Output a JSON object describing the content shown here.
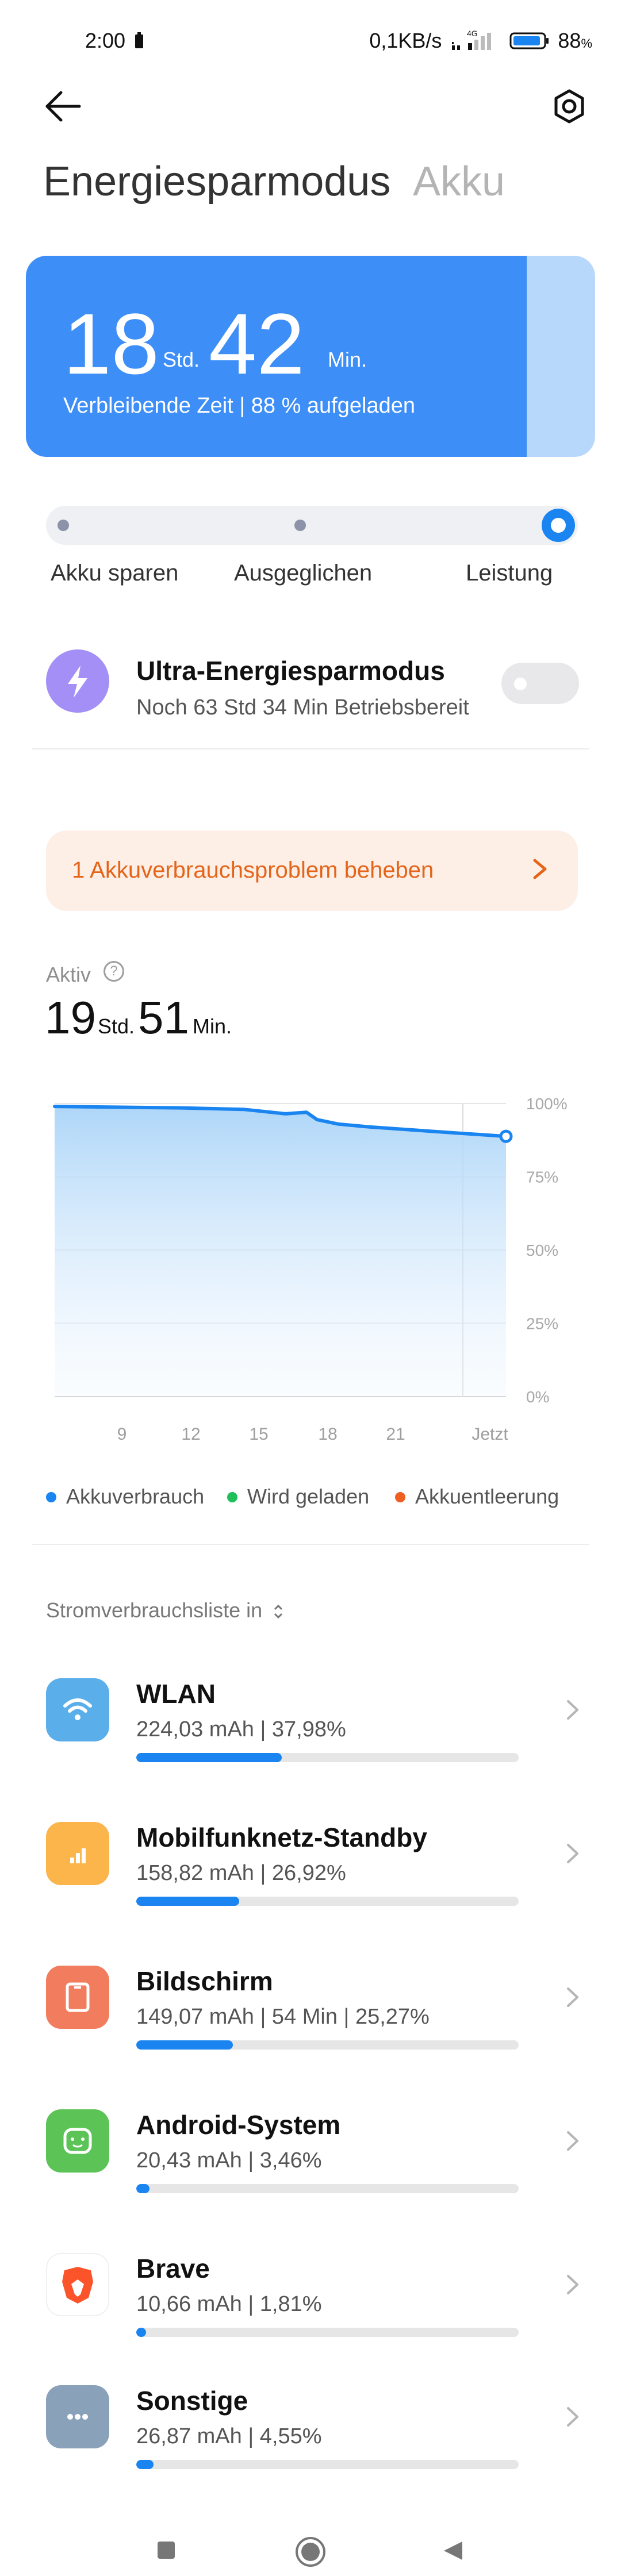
{
  "status_bar": {
    "time": "2:00",
    "speed": "0,1KB/s",
    "network": "4G",
    "battery": "88",
    "battery_unit": "%"
  },
  "header": {
    "tab_active": "Energiesparmodus",
    "tab_inactive": "Akku",
    "back_icon": "arrow-left-icon",
    "settings_icon": "gear-icon"
  },
  "battery_card": {
    "hours": "18",
    "hours_unit": "Std.",
    "minutes": "42",
    "minutes_unit": "Min.",
    "subtitle": "Verbleibende Zeit | 88 % aufgeladen",
    "charge_percent": 88,
    "colors": {
      "fill": "#3d8ef6",
      "empty": "#b7d7fb"
    }
  },
  "modes": {
    "items": [
      "Akku sparen",
      "Ausgeglichen",
      "Leistung"
    ],
    "selected": "Leistung"
  },
  "ultra": {
    "title": "Ultra-Energiesparmodus",
    "subtitle": "Noch 63 Std 34 Min Betriebsbereit",
    "enabled": false,
    "icon": "lightning-icon"
  },
  "problem": {
    "text": "1 Akkuverbrauchsproblem beheben",
    "color": "#e4651a"
  },
  "active": {
    "label": "Aktiv",
    "hours": "19",
    "hours_unit": "Std.",
    "minutes": "51",
    "minutes_unit": "Min."
  },
  "chart_data": {
    "type": "area",
    "x_ticks": [
      "9",
      "12",
      "15",
      "18",
      "21",
      "Jetzt"
    ],
    "y_ticks": [
      "100%",
      "75%",
      "50%",
      "25%",
      "0%"
    ],
    "ylim": [
      0,
      100
    ],
    "series": [
      {
        "name": "Akkuverbrauch",
        "points": [
          [
            0,
            99
          ],
          [
            6,
            98.5
          ],
          [
            9,
            98
          ],
          [
            11,
            96.5
          ],
          [
            12,
            97
          ],
          [
            12.5,
            94.5
          ],
          [
            13.5,
            93
          ],
          [
            15,
            92
          ],
          [
            17,
            91
          ],
          [
            19,
            90
          ],
          [
            21.5,
            88.8
          ]
        ]
      }
    ],
    "x_range": [
      0,
      21.5
    ],
    "legend": [
      {
        "label": "Akkuverbrauch",
        "color": "#1a84f0"
      },
      {
        "label": "Wird geladen",
        "color": "#1fbf5a"
      },
      {
        "label": "Akkuentleerung",
        "color": "#ee5f21"
      }
    ],
    "grid": true
  },
  "list": {
    "header": "Stromverbrauchsliste in",
    "items": [
      {
        "name": "WLAN",
        "detail": "224,03 mAh | 37,98%",
        "percent": 37.98,
        "icon": "wifi-icon",
        "color": "#5aaee9"
      },
      {
        "name": "Mobilfunknetz-Standby",
        "detail": "158,82 mAh | 26,92%",
        "percent": 26.92,
        "icon": "signal-icon",
        "color": "#fbb54b"
      },
      {
        "name": "Bildschirm",
        "detail": "149,07 mAh | 54 Min  | 25,27%",
        "percent": 25.27,
        "icon": "screen-icon",
        "color": "#f27c5e"
      },
      {
        "name": "Android-System",
        "detail": "20,43 mAh | 3,46%",
        "percent": 3.46,
        "icon": "android-icon",
        "color": "#5cc357"
      },
      {
        "name": "Brave",
        "detail": "10,66 mAh | 1,81%",
        "percent": 1.81,
        "icon": "brave-lion-icon",
        "color": "#ffffff"
      },
      {
        "name": "Sonstige",
        "detail": "26,87 mAh | 4,55%",
        "percent": 4.55,
        "icon": "more-dots-icon",
        "color": "#8aa2b9"
      }
    ]
  },
  "nav": {
    "items": [
      "recents-square-icon",
      "home-circle-icon",
      "back-triangle-icon"
    ]
  }
}
